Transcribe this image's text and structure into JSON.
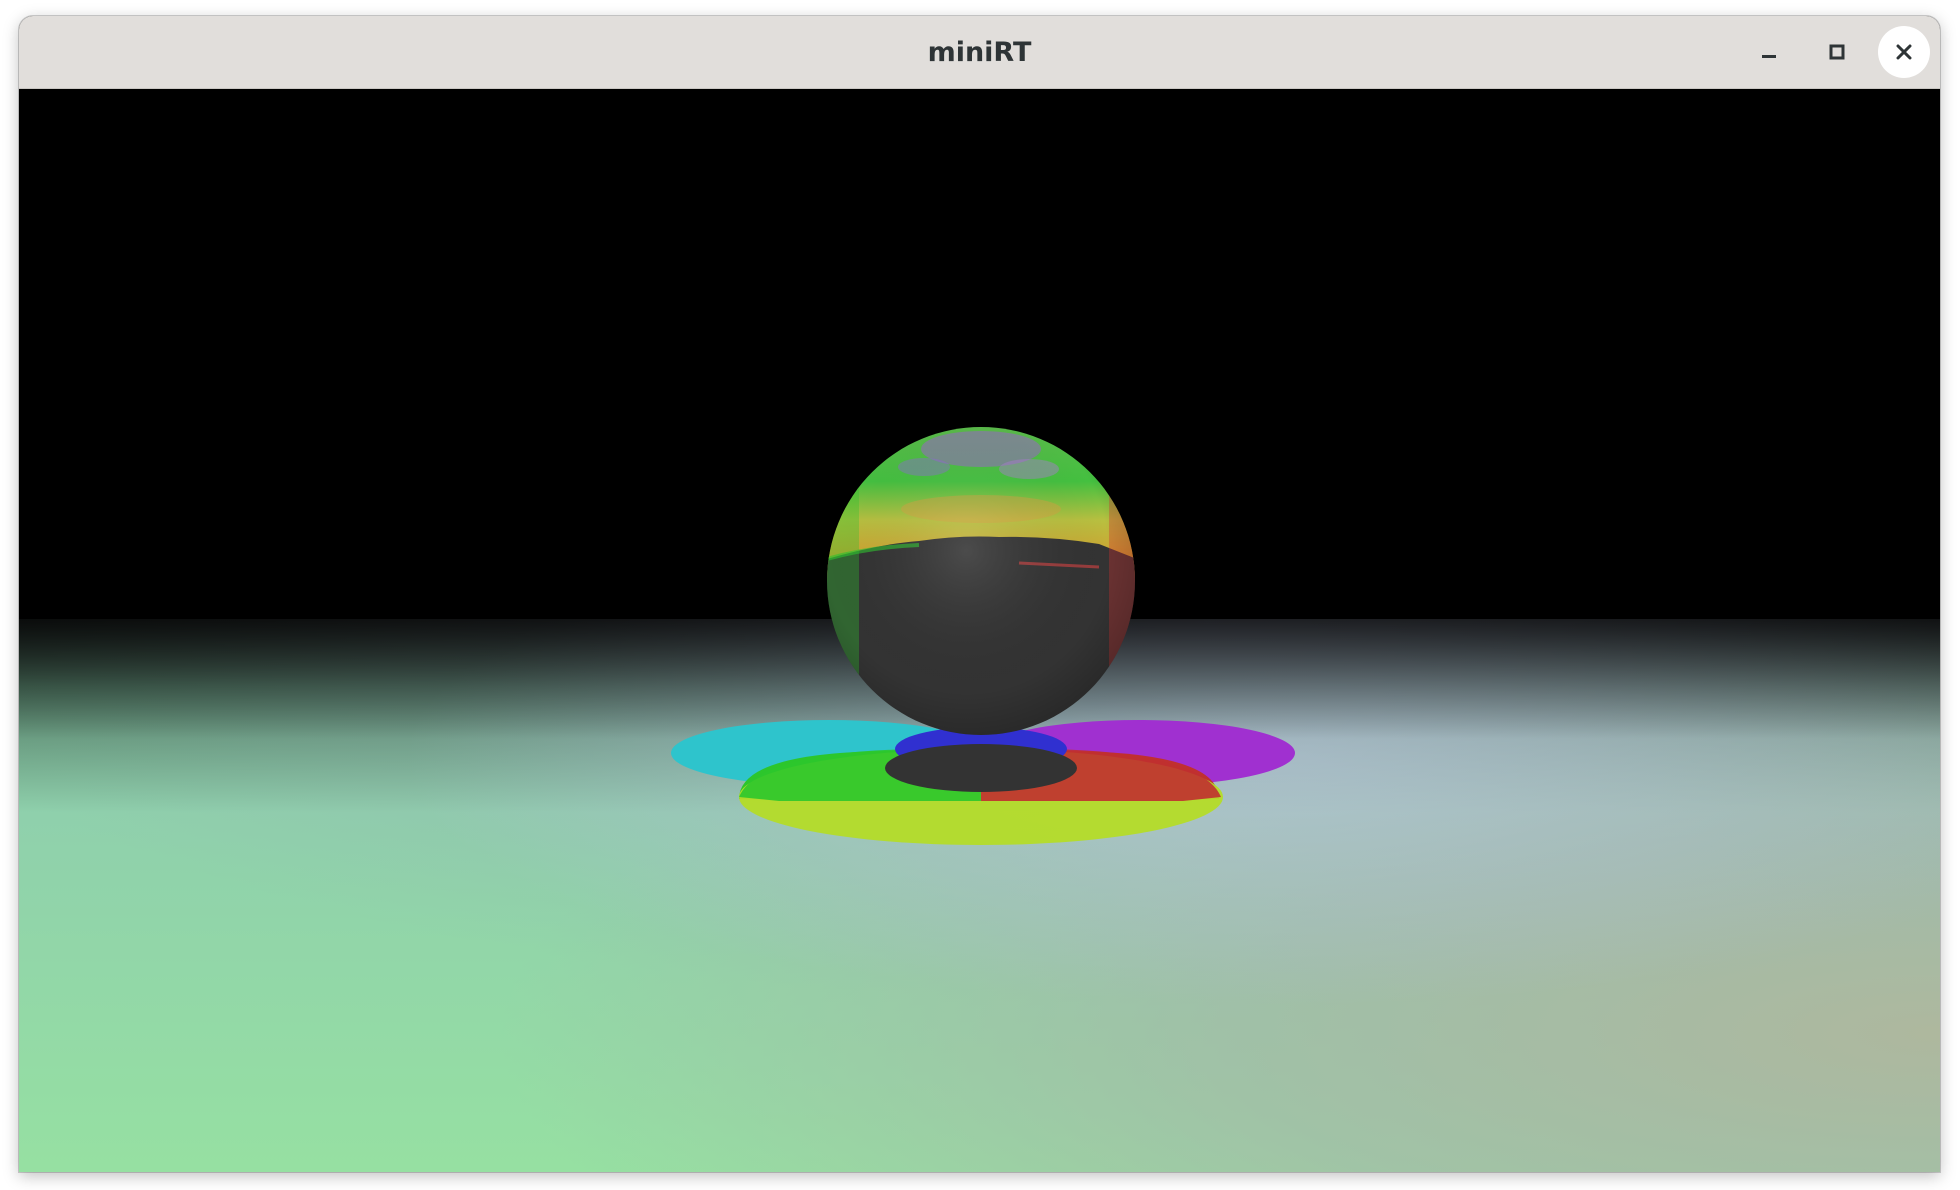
{
  "window": {
    "title": "miniRT"
  },
  "titlebar_buttons": {
    "minimize_icon": "minimize-icon",
    "maximize_icon": "maximize-icon",
    "close_icon": "close-icon"
  },
  "scene": {
    "background_color": "#000000",
    "floor_colors": [
      "#2e3d33",
      "#96e2a8",
      "#b2bca2",
      "#8e90a8"
    ],
    "sphere_colors": [
      "#4cc83e",
      "#c8c040",
      "#333333"
    ],
    "shadow_colors": [
      "#2ec4cc",
      "#a030d0",
      "#2cc62c",
      "#b4dc28",
      "#c03030",
      "#3030d0",
      "#333333"
    ]
  }
}
